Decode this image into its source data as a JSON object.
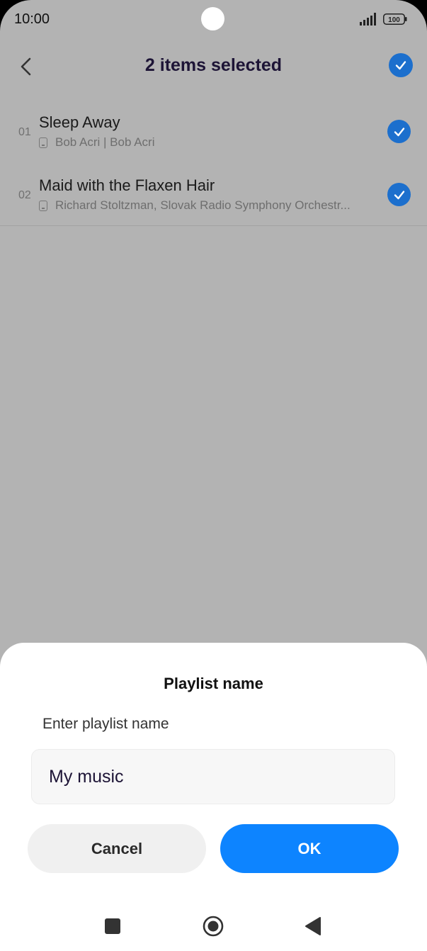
{
  "status_bar": {
    "time": "10:00",
    "battery": "100"
  },
  "header": {
    "title": "2 items selected"
  },
  "songs": [
    {
      "index": "01",
      "title": "Sleep Away",
      "subtitle": "Bob Acri | Bob Acri",
      "selected": true
    },
    {
      "index": "02",
      "title": "Maid with the Flaxen Hair",
      "subtitle": "Richard Stoltzman, Slovak Radio Symphony Orchestr...",
      "selected": true
    }
  ],
  "dialog": {
    "title": "Playlist name",
    "label": "Enter playlist name",
    "input_value": "My music",
    "cancel_label": "Cancel",
    "ok_label": "OK"
  },
  "colors": {
    "accent": "#0d84ff",
    "check": "#1c6fcd",
    "overlay": "#b3b3b3"
  },
  "icons": {
    "back": "chevron-left-icon",
    "select_all": "checkmark-icon",
    "nav_recents": "square-icon",
    "nav_home": "circle-icon",
    "nav_back": "triangle-back-icon"
  }
}
